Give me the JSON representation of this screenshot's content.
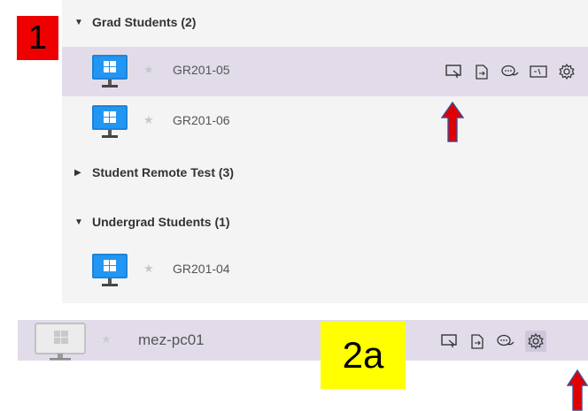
{
  "badges": {
    "first": "1",
    "second": "2a"
  },
  "groups": [
    {
      "label": "Grad Students (2)",
      "state": "expanded"
    },
    {
      "label": "Student Remote Test (3)",
      "state": "collapsed"
    },
    {
      "label": "Undergrad Students (1)",
      "state": "expanded"
    }
  ],
  "computers": [
    {
      "name": "GR201-05",
      "selected": true
    },
    {
      "name": "GR201-06",
      "selected": false
    },
    {
      "name": "GR201-04",
      "selected": false
    }
  ],
  "bottom_row": {
    "name": "mez-pc01",
    "status": "offline"
  },
  "icons": {
    "monitor": "windows-monitor-icon",
    "star": "favorite-star-icon",
    "actions": [
      "remote-control-icon",
      "file-transfer-icon",
      "chat-icon",
      "command-prompt-icon",
      "settings-gear-icon"
    ]
  },
  "colors": {
    "selected_row": "#e2dcea",
    "badge1": "#ee0000",
    "badge2": "#ffff00",
    "arrow": "#e00000"
  }
}
